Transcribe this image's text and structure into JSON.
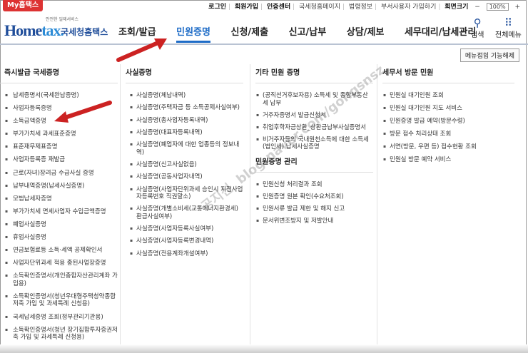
{
  "topbar": {
    "my_tab": "My홈택스",
    "links": [
      "로그인",
      "회원가입",
      "인증센터",
      "국세청홈페이지",
      "법령정보",
      "부서사용자 가입하기",
      "회면크기"
    ],
    "zoom": "100%"
  },
  "header": {
    "logo_small": "안전한 일제서비스",
    "logo_main_a": "Home",
    "logo_main_b": "tax.",
    "logo_sub": "국세청홈택스",
    "nav": [
      "조회/발급",
      "민원증명",
      "신청/제출",
      "신고/납부",
      "상담/제보",
      "세무대리/납세관리"
    ],
    "active_nav": "민원증명",
    "search_label": "검색",
    "all_menu_label": "전체메뉴"
  },
  "menu_close_label": "메뉴접힘 기능해제",
  "columns": {
    "c1": {
      "title": "즉시발급 국세증명",
      "items": [
        "납세증명서(국세완납증명)",
        "사업자등록증명",
        "소득금액증명",
        "부가가치세 과세표준증명",
        "표준재무제표증명",
        "사업자등록증 재발급",
        "근로(자녀)장려금 수급사실 증명",
        "납부내역증명(납세사실증명)",
        "모범납세자증명",
        "부가가치세 면세사업자 수입금액증명",
        "폐업사실증명",
        "휴업사실증명",
        "연금보험료등 소득·세액 공제확인서",
        "사업자단위과세 적용 종된사업장증명",
        "소득확인증명서(개인종합자산관리계좌 가입용)",
        "소득확인증명서(청년우대형주택청약종합저축 가입 및 과세특례 신청용)",
        "국세납세증명 조회(정부관리기관용)",
        "소득확인증명서(청년 장기집합투자증권저축 가입 및 과세특례 신청용)"
      ]
    },
    "c2": {
      "title": "사실증명",
      "items": [
        "사실증명(체납내역)",
        "사실증명(주택자금 등 소득공제사실여부)",
        "사실증명(총사업자등록내역)",
        "사실증명(대표자등록내역)",
        "사실증명(폐업자에 대한 업종등의 정보내역)",
        "사실증명(신고사실없음)",
        "사실증명(공동사업자내역)",
        "사실증명(사업자단위과세 승인시 지점사업자등록번호 직권말소)",
        "사실증명(개별소비세(교통에너지환경세) 환급사실여부)",
        "사실증명(사업자등록사실여부)",
        "사실증명(사업자등록변경내역)",
        "사실증명(전용계좌개설여부)"
      ]
    },
    "c3": {
      "title": "기타 민원 증명",
      "items": [
        "(공직선거후보자용) 소득세 및 종합부동산세 납부",
        "거주자증명서 발급신청서",
        "취업후학자금상환_상환금납부사실증명서",
        "비거주자등의 국내원천소득에 대한 소득세(법인세) 납세사실증명"
      ],
      "title2": "민원증명 관리",
      "items2": [
        "민원신청 처리결과 조회",
        "민원증명 원본 확인(수요처조회)",
        "민원서류 발급 제한 및 해지 신고",
        "문서위변조방지 및 저발안내"
      ]
    },
    "c4": {
      "title": "세무서 방문 민원",
      "items": [
        "민원실 대기인원 조회",
        "민원실 대기인원 지도 서비스",
        "민원증명 발급 예약(방문수령)",
        "방문 접수 처리상태 조회",
        "서면(방문, 우편 등) 접수현황 조회",
        "민원실 방문 예약 서비스"
      ]
    }
  },
  "watermark": "blog.naver.com/gongsnsz",
  "watermark_name": "공지신",
  "colors": {
    "accent": "#1e6cc7",
    "brand": "#1f4d9a",
    "arrow": "#cc2222",
    "my_tab": "#dd3333"
  }
}
